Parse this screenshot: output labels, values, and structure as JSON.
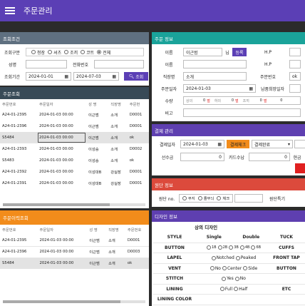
{
  "app": {
    "title": "주문관리"
  },
  "search": {
    "header": "조회조건",
    "type_label": "조회구분",
    "types": [
      "청장",
      "셔츠",
      "조끼",
      "코트",
      "전체"
    ],
    "name_label": "성명",
    "phone_label": "전화번호",
    "period_label": "조회기간",
    "date_from": "2024-01-01",
    "date_to": "2024-07-03",
    "search_button": "조회"
  },
  "orders": {
    "header": "주문조회",
    "columns": [
      "주문번호",
      "주문일자",
      "성 명",
      "직장명",
      "주문번"
    ],
    "rows": [
      [
        "A24-01-2395",
        "2024-01-03 00:00",
        "이근범",
        "소개",
        "D0001"
      ],
      [
        "A24-01-2396",
        "2024-01-03 00:00",
        "이근범",
        "소개",
        "D0001"
      ],
      [
        "S5484",
        "2024-01-03 00:00",
        "이근범",
        "소개",
        "ok"
      ],
      [
        "A24-01-2393",
        "2024-01-03 00:00",
        "이성승",
        "소개",
        "D0002"
      ],
      [
        "S5483",
        "2024-01-03 00:00",
        "이성승",
        "소개",
        "ok"
      ],
      [
        "A24-01-2392",
        "2024-01-03 00:00",
        "이성대B",
        "강실장",
        "D0001"
      ],
      [
        "A24-01-2391",
        "2024-01-03 00:00",
        "이성대B",
        "강실장",
        "D0001"
      ]
    ]
  },
  "history": {
    "header": "주문이력조회",
    "columns": [
      "주문번호",
      "주문일자",
      "성 명",
      "직장명",
      "주문번호"
    ],
    "rows": [
      [
        "A24-01-2395",
        "2024-01-03 00:00",
        "이근범",
        "소개",
        "D0001"
      ],
      [
        "A24-01-2396",
        "2024-01-03 00:00",
        "이근범",
        "소개",
        "D0003"
      ],
      [
        "S5484",
        "2024-01-03 00:00",
        "이근범",
        "소개",
        "ok"
      ]
    ]
  },
  "order_info": {
    "header": "주문 정보",
    "name_label": "이름",
    "name_value": "이근범",
    "honorific": "님",
    "lookup_button": "등록",
    "hp_label": "H.P",
    "name2_label": "이름",
    "hp2_label": "H.P",
    "work_label": "직장명",
    "work_value": "소개",
    "order_no_label": "주문번호",
    "order_no_value": "ok",
    "order_date_label": "주문일자",
    "order_date_value": "2024-01-03",
    "delivery_label": "납품희망일자",
    "qty_label": "수량",
    "qty_items": [
      {
        "name": "상의",
        "unit": "벌",
        "value": "0"
      },
      {
        "name": "하의",
        "unit": "벌",
        "value": "0"
      },
      {
        "name": "조끼",
        "unit": "벌",
        "value": "0"
      },
      {
        "name": "",
        "unit": "",
        "value": "0"
      }
    ],
    "memo_label": "비고"
  },
  "payment": {
    "header": "결제 관리",
    "date_label": "결제일자",
    "date_value": "2024-01-03",
    "check_button": "결제체크",
    "status_value": "결제완료",
    "deposit_label": "선수금",
    "deposit_value": "0",
    "card_label": "카드수납",
    "card_value": "0",
    "cash_label": "현금"
  },
  "detail": {
    "header": "원단 정보",
    "no_label": "원단 no.",
    "options": [
      "무지",
      "줄무늬",
      "체크"
    ],
    "special_label": "원단특기"
  },
  "design": {
    "header": "디자인 정보",
    "top_title": "상의 디자인",
    "rows": [
      {
        "label": "STYLE",
        "opts": [
          "Single",
          "Double"
        ],
        "right": "TUCK"
      },
      {
        "label": "BUTTON",
        "opts": [
          "1B",
          "2B",
          "3B",
          "4B",
          "6B"
        ],
        "right": "CUFFS"
      },
      {
        "label": "LAPEL",
        "opts": [
          "Notched",
          "Peaked"
        ],
        "right": "FRONT TAP"
      },
      {
        "label": "VENT",
        "opts": [
          "No",
          "Center",
          "Side"
        ],
        "right": "BUTTON"
      },
      {
        "label": "STITCH",
        "opts": [
          "Yes",
          "No"
        ],
        "right": ""
      },
      {
        "label": "LINING",
        "opts": [
          "Full",
          "Half"
        ],
        "right": "ETC"
      },
      {
        "label": "LINING COLOR",
        "opts": [],
        "right": ""
      }
    ]
  },
  "colors": {
    "purple": "#5b3fb5",
    "teal": "#1aa39a",
    "orange": "#f28c1b",
    "red": "#dc4a3c",
    "slate": "#384a57",
    "accent_red": "#e02020"
  }
}
